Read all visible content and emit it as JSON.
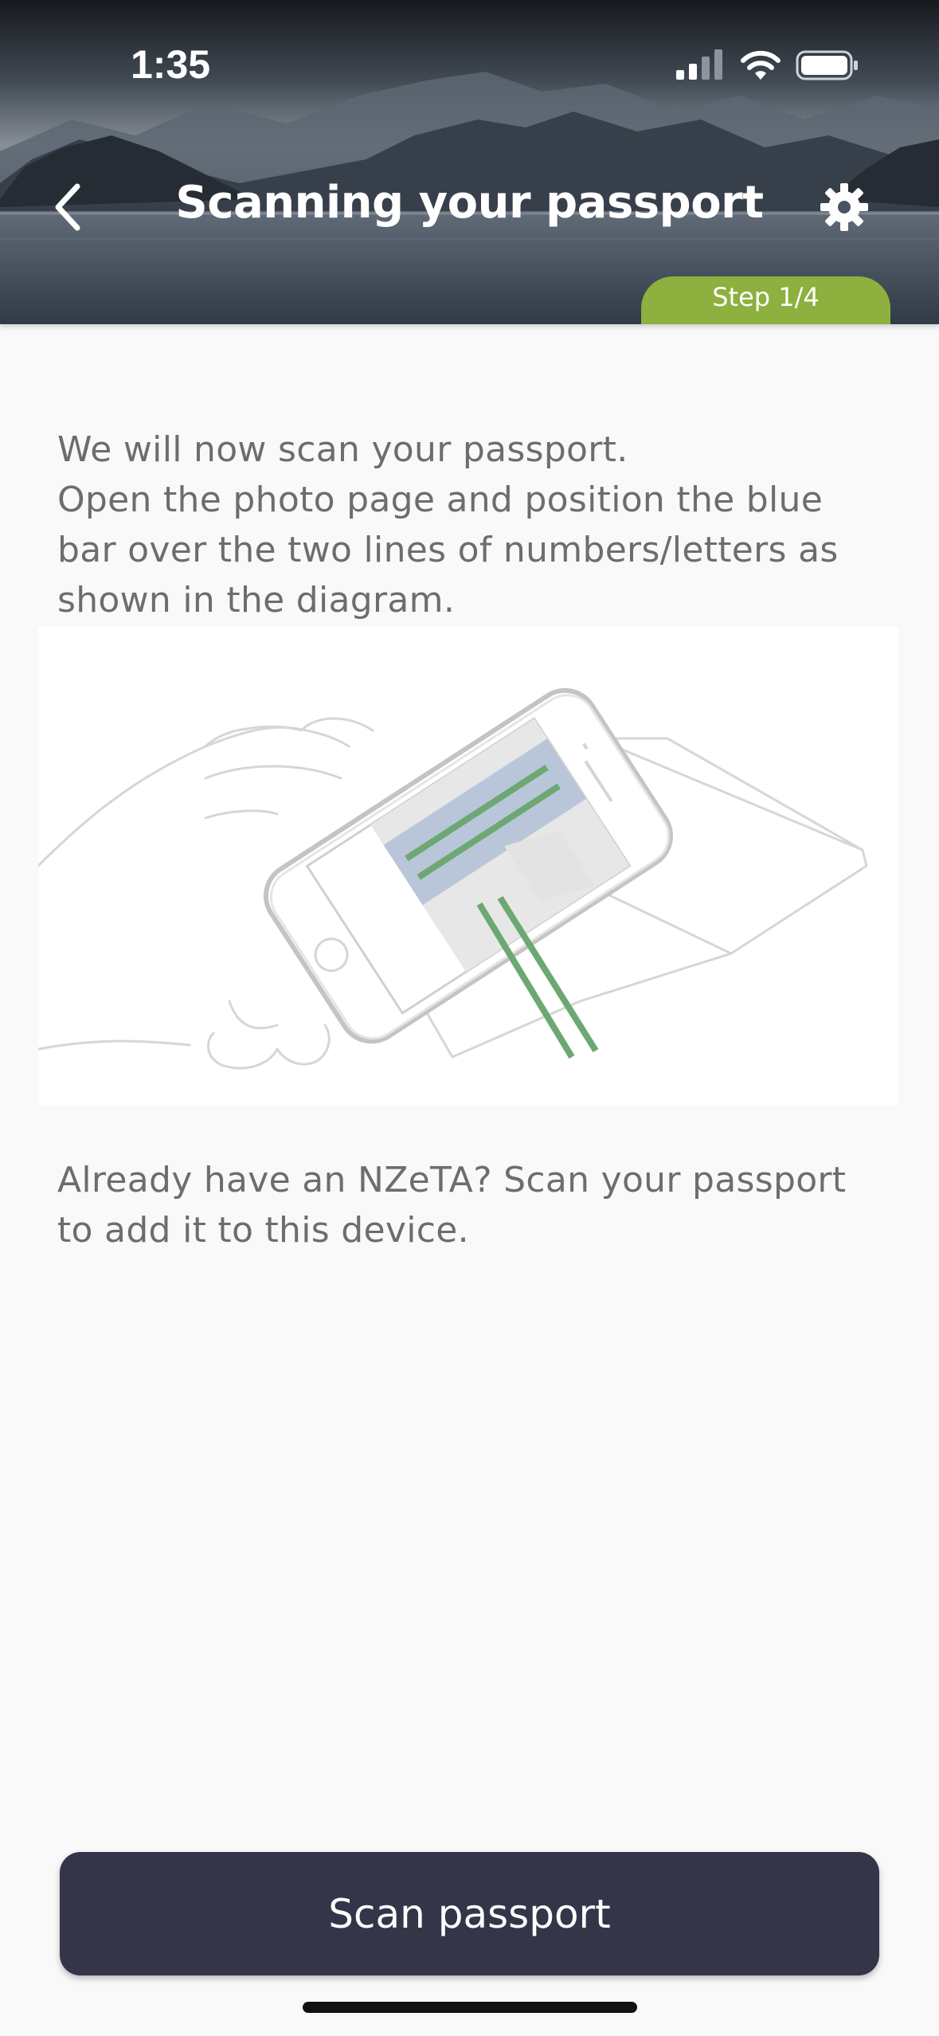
{
  "status_bar": {
    "time": "1:35"
  },
  "header": {
    "title": "Scanning your passport",
    "back_icon": "chevron-left-icon",
    "settings_icon": "gear-icon",
    "step_label": "Step 1/4"
  },
  "instructions": {
    "line1": "We will now scan your passport.",
    "line2": "Open the photo page and position the blue bar over the two lines of numbers/letters as shown in the diagram."
  },
  "secondary_text": "Already have an NZeTA? Scan your passport to add it to this device.",
  "primary_button": {
    "label": "Scan passport"
  },
  "colors": {
    "step_badge": "#8db03e",
    "primary_button": "#343548",
    "body_text": "#6b6d70",
    "scan_bar_blue": "#b9c6da",
    "mrz_lines_green": "#6da872"
  }
}
